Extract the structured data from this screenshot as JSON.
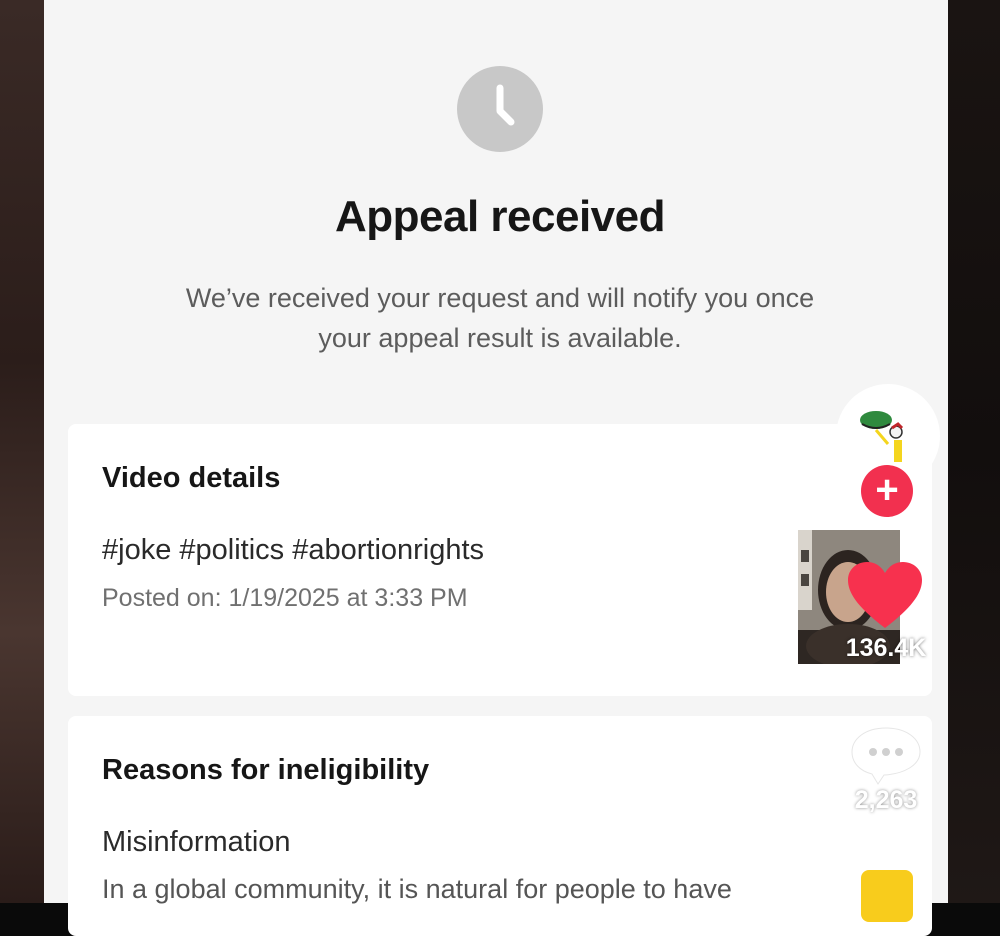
{
  "appeal": {
    "title": "Appeal received",
    "subtitle_line1": "We’ve received your request and will notify you once",
    "subtitle_line2": "your appeal result is available."
  },
  "video_details": {
    "heading": "Video details",
    "hashtags": "#joke #politics #abortionrights",
    "posted": "Posted on: 1/19/2025 at 3:33 PM"
  },
  "reasons": {
    "heading": "Reasons for ineligibility",
    "reason_title": "Misinformation",
    "reason_text": "In a global community, it is natural for people to have"
  },
  "overlay": {
    "like_count": "136.4K",
    "comment_count": "2,263",
    "follow_symbol": "+",
    "icons": [
      "clock-icon",
      "heart-icon",
      "comment-icon",
      "plus-icon",
      "bookmark-icon"
    ]
  },
  "colors": {
    "accent_red": "#f2304f",
    "save_yellow": "#f8cc1c",
    "clock_gray": "#c8c8c8"
  }
}
